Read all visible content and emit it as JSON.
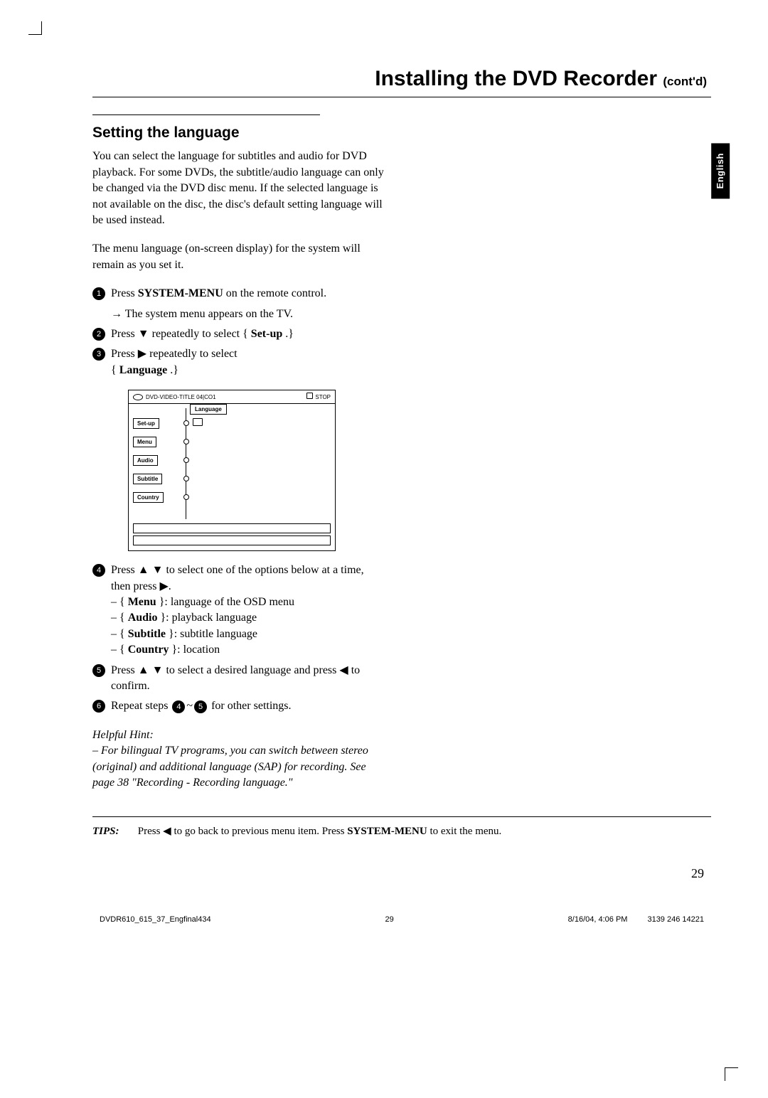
{
  "header": {
    "title_main": "Installing the DVD Recorder",
    "title_suffix": "(cont'd)"
  },
  "lang_tab": "English",
  "section": {
    "heading": "Setting the language",
    "para1": "You can select the language for subtitles and audio for DVD playback.  For some DVDs, the subtitle/audio language can only be changed via the DVD disc menu.  If the selected language is not available on the disc, the disc's default setting language will be used instead.",
    "para2": "The menu language (on-screen display) for the system will remain as you set it."
  },
  "steps": {
    "s1_a": "Press ",
    "s1_bold": "SYSTEM-MENU",
    "s1_b": " on the remote control.",
    "s1_result": "The system menu appears on the TV.",
    "s2_a": "Press ",
    "s2_b": " repeatedly to select { ",
    "s2_bold": "Set-up",
    "s2_c": " .}",
    "s3_a": "Press ",
    "s3_b": " repeatedly to select",
    "s3_c": "{ ",
    "s3_bold": "Language",
    "s3_d": " .}",
    "s4_a": "Press ",
    "s4_b": " to select one of the options below at a time, then press ",
    "s4_c": ".",
    "s4_items": {
      "menu_label": "Menu",
      "menu_desc": " }: language of the OSD menu",
      "audio_label": "Audio",
      "audio_desc": " }: playback language",
      "subtitle_label": "Subtitle",
      "subtitle_desc": " }: subtitle language",
      "country_label": "Country",
      "country_desc": " }: location"
    },
    "s5_a": "Press ",
    "s5_b": " to select a desired language and press ",
    "s5_c": " to confirm.",
    "s6_a": "Repeat steps ",
    "s6_b": "~",
    "s6_c": " for other settings."
  },
  "menu_diagram": {
    "header_title": "DVD-VIDEO-TITLE 04|CO1",
    "header_stop": "STOP",
    "language_btn": "Language",
    "items": [
      "Set-up",
      "Menu",
      "Audio",
      "Subtitle",
      "Country"
    ]
  },
  "hint": {
    "heading": "Helpful Hint:",
    "body": "–  For bilingual TV programs, you can switch between stereo (original) and additional language (SAP) for recording. See page 38 \"Recording - Recording language.\""
  },
  "tips": {
    "label": "TIPS:",
    "text_a": "Press ",
    "text_b": " to go back to previous menu item.  Press ",
    "text_bold": "SYSTEM-MENU",
    "text_c": " to exit the menu."
  },
  "pagenum": "29",
  "footer": {
    "left": "DVDR610_615_37_Engfinal434",
    "mid": "29",
    "date": "8/16/04, 4:06 PM",
    "code": "3139 246 14221"
  }
}
